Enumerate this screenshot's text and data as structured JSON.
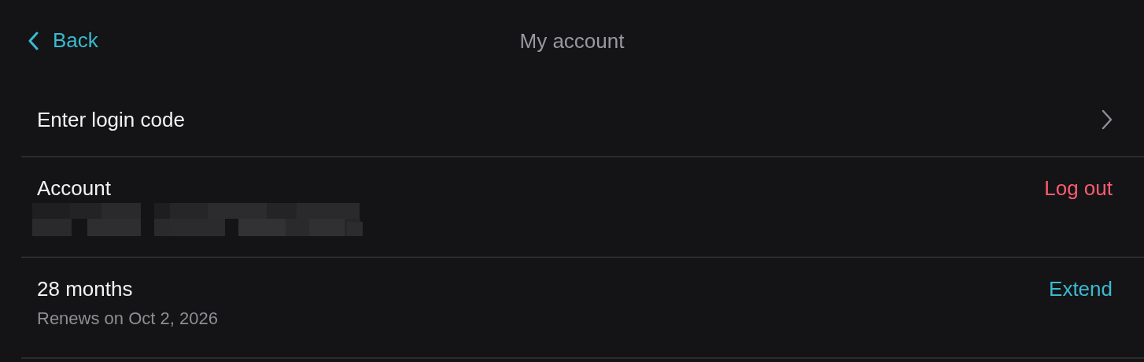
{
  "nav": {
    "back_label": "Back",
    "title": "My account"
  },
  "rows": [
    {
      "kind": "link",
      "label": "Enter login code"
    },
    {
      "kind": "account",
      "label": "Account",
      "redacted": true,
      "action": "Log out",
      "color": "#ff5c72"
    },
    {
      "kind": "subscription",
      "label": "28 months",
      "subtitle": "Renews on Oct 2, 2026",
      "action": "Extend",
      "color": "#3bbad0"
    }
  ]
}
